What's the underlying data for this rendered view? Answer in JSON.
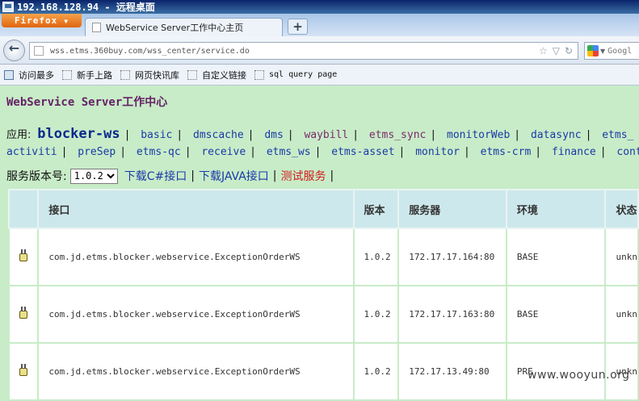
{
  "remote_desktop": {
    "title": "192.168.128.94 - 远程桌面"
  },
  "browser": {
    "firefox_label": "Firefox",
    "tab_title": "WebService Server工作中心主页",
    "new_tab": "+",
    "url": "wss.etms.360buy.com/wss_center/service.do",
    "search_placeholder": "Googl",
    "bookmarks": [
      "访问最多",
      "新手上路",
      "网页快讯库",
      "自定义链接",
      "sql query page"
    ]
  },
  "page": {
    "site_title": "WebService Server工作中心",
    "apps_label": "应用:",
    "current_app": "blocker-ws",
    "apps_row1": [
      "basic",
      "dmscache",
      "dms",
      "waybill",
      "etms_sync",
      "monitorWeb",
      "datasync",
      "etms_"
    ],
    "apps_row2": [
      "activiti",
      "preSep",
      "etms-qc",
      "receive",
      "etms_ws",
      "etms-asset",
      "monitor",
      "etms-crm",
      "finance",
      "cont"
    ],
    "version_label": "服务版本号:",
    "version_selected": "1.0.2",
    "links": {
      "csharp": "下载C#接口",
      "java": "下载JAVA接口",
      "test": "测试服务"
    }
  },
  "table": {
    "headers": [
      "接口",
      "版本",
      "服务器",
      "环境",
      "状态"
    ],
    "rows": [
      {
        "interface": "com.jd.etms.blocker.webservice.ExceptionOrderWS",
        "version": "1.0.2",
        "server": "172.17.17.164:80",
        "env": "BASE",
        "status": "unkn"
      },
      {
        "interface": "com.jd.etms.blocker.webservice.ExceptionOrderWS",
        "version": "1.0.2",
        "server": "172.17.17.163:80",
        "env": "BASE",
        "status": "unkn"
      },
      {
        "interface": "com.jd.etms.blocker.webservice.ExceptionOrderWS",
        "version": "1.0.2",
        "server": "172.17.13.49:80",
        "env": "PRE",
        "status": "unkn"
      }
    ]
  },
  "watermark": "www.wooyun.org"
}
